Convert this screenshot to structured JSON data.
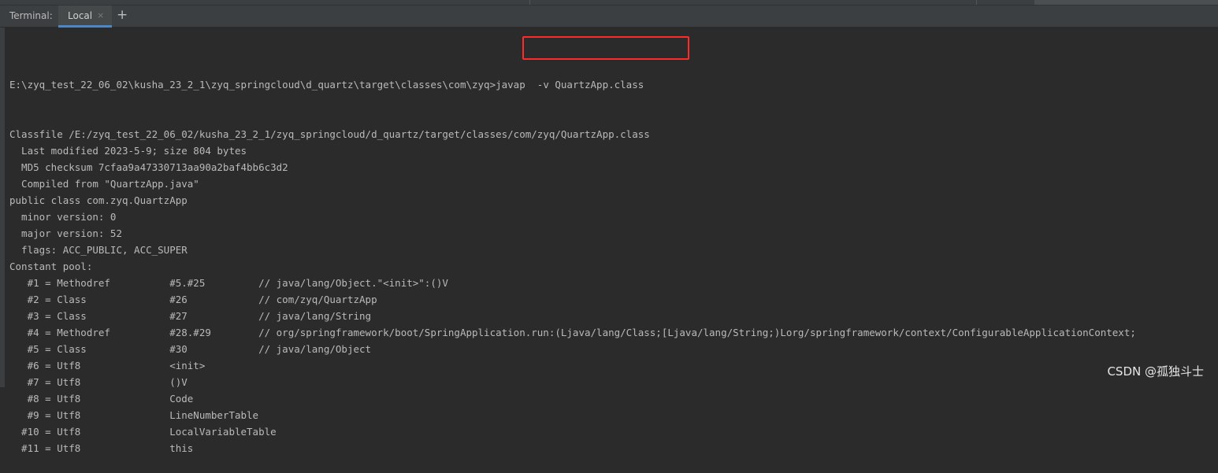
{
  "tabbar": {
    "label": "Terminal:",
    "tab_local": "Local",
    "close_glyph": "×",
    "add_glyph": "+"
  },
  "terminal": {
    "prompt_path": "E:\\zyq_test_22_06_02\\kusha_23_2_1\\zyq_springcloud\\d_quartz\\target\\classes\\com\\zyq>",
    "command": "javap  -v QuartzApp.class",
    "lines": [
      "Classfile /E:/zyq_test_22_06_02/kusha_23_2_1/zyq_springcloud/d_quartz/target/classes/com/zyq/QuartzApp.class",
      "  Last modified 2023-5-9; size 804 bytes",
      "  MD5 checksum 7cfaa9a47330713aa90a2baf4bb6c3d2",
      "  Compiled from \"QuartzApp.java\"",
      "public class com.zyq.QuartzApp",
      "  minor version: 0",
      "  major version: 52",
      "  flags: ACC_PUBLIC, ACC_SUPER",
      "Constant pool:",
      "   #1 = Methodref          #5.#25         // java/lang/Object.\"<init>\":()V",
      "   #2 = Class              #26            // com/zyq/QuartzApp",
      "   #3 = Class              #27            // java/lang/String",
      "   #4 = Methodref          #28.#29        // org/springframework/boot/SpringApplication.run:(Ljava/lang/Class;[Ljava/lang/String;)Lorg/springframework/context/ConfigurableApplicationContext;",
      "   #5 = Class              #30            // java/lang/Object",
      "   #6 = Utf8               <init>",
      "   #7 = Utf8               ()V",
      "   #8 = Utf8               Code",
      "   #9 = Utf8               LineNumberTable",
      "  #10 = Utf8               LocalVariableTable",
      "  #11 = Utf8               this"
    ]
  },
  "watermark": "CSDN @孤独斗士",
  "colors": {
    "background": "#2b2b2b",
    "text": "#bababa",
    "highlight_border": "#ff2a2a",
    "tab_accent": "#4a88c7"
  }
}
